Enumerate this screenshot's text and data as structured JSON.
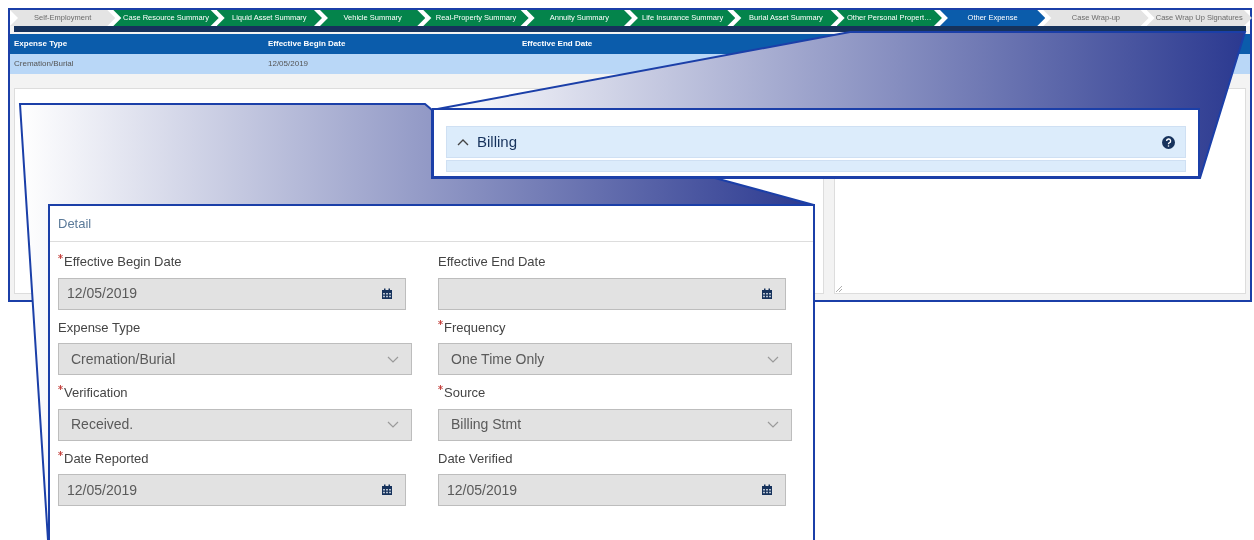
{
  "steps": [
    {
      "label": "Self-Employment",
      "completed": false,
      "selected": false
    },
    {
      "label": "Case Resource Summary",
      "completed": true,
      "selected": false
    },
    {
      "label": "Liquid Asset Summary",
      "completed": true,
      "selected": false
    },
    {
      "label": "Vehicle Summary",
      "completed": true,
      "selected": false
    },
    {
      "label": "Real-Property Summary",
      "completed": true,
      "selected": false
    },
    {
      "label": "Annuity Summary",
      "completed": true,
      "selected": false
    },
    {
      "label": "Life Insurance Summary",
      "completed": true,
      "selected": false
    },
    {
      "label": "Burial Asset Summary",
      "completed": true,
      "selected": false
    },
    {
      "label": "Other Personal Propert…",
      "completed": true,
      "selected": false
    },
    {
      "label": "Other Expense",
      "selected": true
    },
    {
      "label": "Case Wrap-up",
      "completed": false,
      "selected": false
    },
    {
      "label": "Case Wrap Up Signatures",
      "completed": false,
      "selected": false
    }
  ],
  "table": {
    "columns": [
      "Expense Type",
      "Effective Begin Date",
      "Effective End Date"
    ],
    "rows": [
      {
        "expense_type": "Cremation/Burial",
        "effective_begin_date": "12/05/2019",
        "selected": true
      }
    ]
  },
  "billing_section": {
    "title": "Billing",
    "expanded": true
  },
  "detail": {
    "title": "Detail",
    "fields": [
      {
        "label": "Effective Begin Date",
        "required": true,
        "kind": "date",
        "value": "12/05/2019"
      },
      {
        "label": "Effective End Date",
        "required": false,
        "kind": "date"
      },
      {
        "label": "Expense Type",
        "required": false,
        "kind": "select",
        "value": "Cremation/Burial"
      },
      {
        "label": "Frequency",
        "required": true,
        "kind": "select",
        "value": "One Time Only"
      },
      {
        "label": "Verification",
        "required": true,
        "kind": "select",
        "value": "Received."
      },
      {
        "label": "Source",
        "required": true,
        "kind": "select",
        "value": "Billing Stmt"
      },
      {
        "label": "Date Reported",
        "required": true,
        "kind": "date",
        "value": "12/05/2019"
      },
      {
        "label": "Date Verified",
        "required": false,
        "kind": "date",
        "value": "12/05/2019"
      }
    ]
  }
}
